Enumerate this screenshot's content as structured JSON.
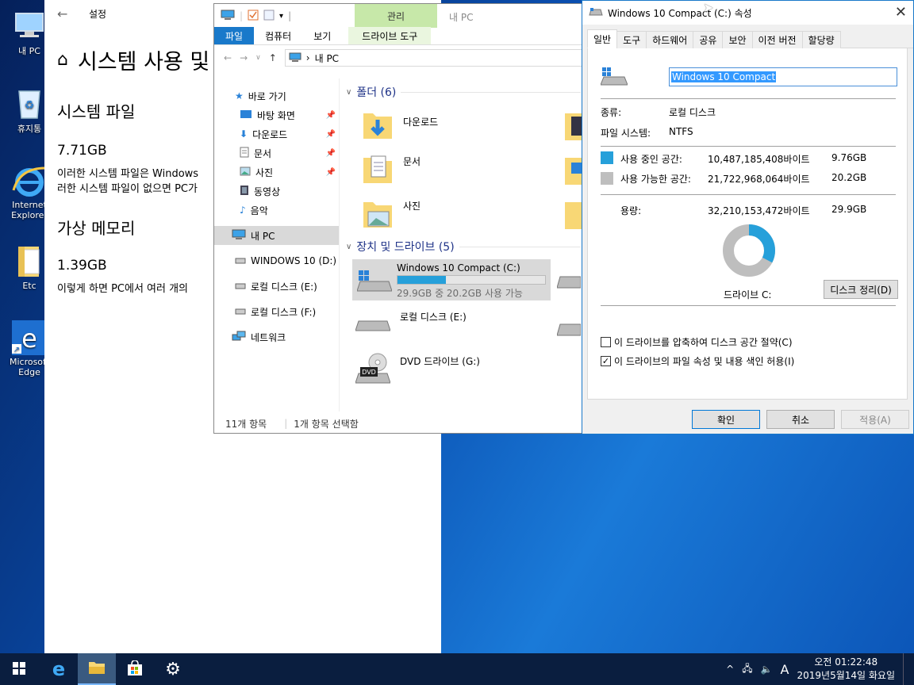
{
  "desktop": {
    "icons": [
      {
        "label": "내 PC",
        "icon": "computer-icon"
      },
      {
        "label": "휴지통",
        "icon": "recycle-bin-icon"
      },
      {
        "label": "Internet Explorer",
        "icon": "internet-explorer-icon"
      },
      {
        "label": "Etc",
        "icon": "folder-icon"
      },
      {
        "label": "Microsoft Edge",
        "icon": "edge-icon"
      }
    ]
  },
  "settings": {
    "window_title": "설정",
    "page_title": "시스템 사용 및",
    "system_files_heading": "시스템 파일",
    "system_files_size": "7.71GB",
    "system_files_desc_1": "이러한 시스템 파일은 Windows",
    "system_files_desc_2": "러한 시스템 파일이 없으면 PC가",
    "virtual_memory_heading": "가상 메모리",
    "virtual_memory_size": "1.39GB",
    "virtual_memory_desc": "이렇게 하면 PC에서 여러 개의 "
  },
  "explorer": {
    "title": "내 PC",
    "context_tab_top": "관리",
    "tabs": [
      "파일",
      "컴퓨터",
      "보기",
      "드라이브 도구"
    ],
    "address": "내 PC",
    "nav": {
      "quick_access": "바로 가기",
      "items": [
        "바탕 화면",
        "다운로드",
        "문서",
        "사진",
        "동영상",
        "음악"
      ],
      "this_pc": "내 PC",
      "drives": [
        "WINDOWS 10 (D:)",
        "로컬 디스크 (E:)",
        "로컬 디스크 (F:)"
      ],
      "network": "네트워크"
    },
    "folders_group": "폴더 (6)",
    "folders": [
      "다운로드",
      "문서",
      "사진"
    ],
    "devices_group": "장치 및 드라이브 (5)",
    "drives": [
      {
        "name": "Windows 10 Compact (C:)",
        "detail": "29.9GB 중 20.2GB 사용 가능",
        "used_fraction": 0.33
      },
      {
        "name": "로컬 디스크 (E:)"
      },
      {
        "name": "DVD 드라이브 (G:)"
      }
    ],
    "status_count": "11개 항목",
    "status_selected": "1개 항목 선택함"
  },
  "properties": {
    "title": "Windows 10 Compact (C:) 속성",
    "tabs": [
      "일반",
      "도구",
      "하드웨어",
      "공유",
      "보안",
      "이전 버전",
      "할당량"
    ],
    "volume_name": "Windows 10 Compact",
    "type_label": "종류:",
    "type_value": "로컬 디스크",
    "fs_label": "파일 시스템:",
    "fs_value": "NTFS",
    "used_label": "사용 중인 공간:",
    "used_bytes": "10,487,185,408바이트",
    "used_gb": "9.76GB",
    "free_label": "사용 가능한 공간:",
    "free_bytes": "21,722,968,064바이트",
    "free_gb": "20.2GB",
    "capacity_label": "용량:",
    "capacity_bytes": "32,210,153,472바이트",
    "capacity_gb": "29.9GB",
    "used_fraction": 0.326,
    "drive_label": "드라이브 C:",
    "cleanup_button": "디스크 정리(D)",
    "compress_label": "이 드라이브를 압축하여 디스크 공간 절약(C)",
    "index_label": "이 드라이브의 파일 속성 및 내용 색인 허용(I)",
    "ok_button": "확인",
    "cancel_button": "취소",
    "apply_button": "적용(A)",
    "colors": {
      "used": "#26a0da",
      "free": "#bebebe"
    }
  },
  "taskbar": {
    "ime": "A",
    "time": "오전 01:22:48",
    "date": "2019년5월14일 화요일"
  }
}
